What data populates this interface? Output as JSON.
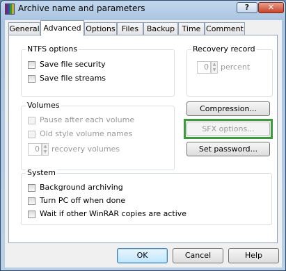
{
  "window": {
    "title": "Archive name and parameters",
    "help_btn": "?",
    "close_btn": "✕"
  },
  "tabs": [
    "General",
    "Advanced",
    "Options",
    "Files",
    "Backup",
    "Time",
    "Comment"
  ],
  "active_tab": "Advanced",
  "ntfs": {
    "title": "NTFS options",
    "save_security": "Save file security",
    "save_streams": "Save file streams"
  },
  "recovery": {
    "title": "Recovery record",
    "value": "0",
    "unit": "percent"
  },
  "volumes": {
    "title": "Volumes",
    "pause": "Pause after each volume",
    "old_names": "Old style volume names",
    "recovery_value": "0",
    "recovery_unit": "recovery volumes"
  },
  "buttons": {
    "compression": "Compression...",
    "sfx": "SFX options...",
    "password": "Set password...",
    "ok": "OK",
    "cancel": "Cancel",
    "help": "Help"
  },
  "system": {
    "title": "System",
    "background": "Background archiving",
    "turn_off": "Turn PC off when done",
    "wait": "Wait if other WinRAR copies are active"
  },
  "colors": {
    "highlight": "#3b9c3b"
  }
}
